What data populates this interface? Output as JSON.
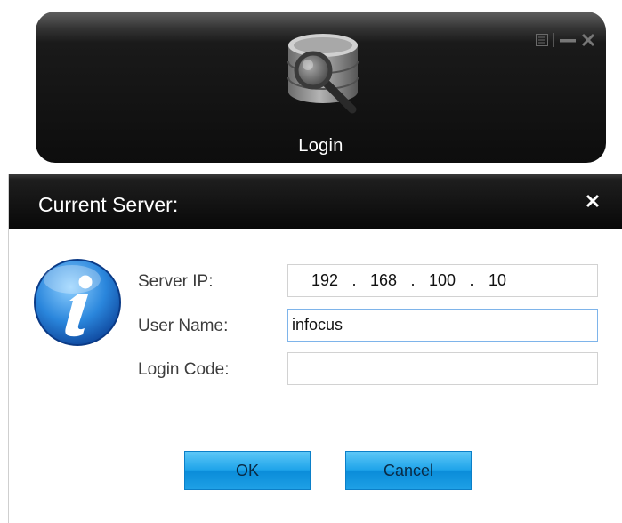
{
  "login_panel": {
    "caption": "Login",
    "icons": {
      "menu": "menu-list-icon",
      "minimize": "minimize-icon",
      "close": "close-icon",
      "app": "database-search-icon"
    }
  },
  "dialog": {
    "title": "Current Server:",
    "close_icon": "close-icon",
    "info_icon": "info-icon",
    "fields": {
      "server_ip": {
        "label": "Server IP:",
        "octets": [
          "192",
          "168",
          "100",
          "10"
        ],
        "separator": "."
      },
      "user_name": {
        "label": "User Name:",
        "value": "infocus"
      },
      "login_code": {
        "label": "Login Code:",
        "value": ""
      }
    },
    "buttons": {
      "ok": "OK",
      "cancel": "Cancel"
    }
  },
  "colors": {
    "panel_bg": "#0d0d0d",
    "button_blue": "#1fa4ea",
    "focus_border": "#7eb4ea"
  }
}
